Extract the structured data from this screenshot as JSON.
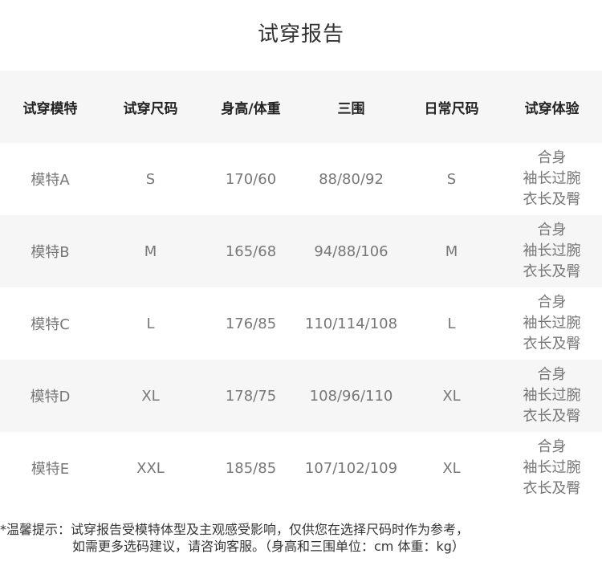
{
  "title": "试穿报告",
  "headers": [
    "试穿模特",
    "试穿尺码",
    "身高/体重",
    "三围",
    "日常尺码",
    "试穿体验"
  ],
  "rows": [
    {
      "model": "模特A",
      "size": "S",
      "height_weight": "170/60",
      "measurements": "88/80/92",
      "daily_size": "S",
      "experience": [
        "合身",
        "袖长过腕",
        "衣长及臀"
      ]
    },
    {
      "model": "模特B",
      "size": "M",
      "height_weight": "165/68",
      "measurements": "94/88/106",
      "daily_size": "M",
      "experience": [
        "合身",
        "袖长过腕",
        "衣长及臀"
      ]
    },
    {
      "model": "模特C",
      "size": "L",
      "height_weight": "176/85",
      "measurements": "110/114/108",
      "daily_size": "L",
      "experience": [
        "合身",
        "袖长过腕",
        "衣长及臀"
      ]
    },
    {
      "model": "模特D",
      "size": "XL",
      "height_weight": "178/75",
      "measurements": "108/96/110",
      "daily_size": "XL",
      "experience": [
        "合身",
        "袖长过腕",
        "衣长及臀"
      ]
    },
    {
      "model": "模特E",
      "size": "XXL",
      "height_weight": "185/85",
      "measurements": "107/102/109",
      "daily_size": "XL",
      "experience": [
        "合身",
        "袖长过腕",
        "衣长及臀"
      ]
    }
  ],
  "note": {
    "line1": "*温馨提示：试穿报告受模特体型及主观感受影响，仅供您在选择尺码时作为参考，",
    "line2": "如需更多选码建议，请咨询客服。（身高和三围单位：cm  体重：kg）"
  }
}
